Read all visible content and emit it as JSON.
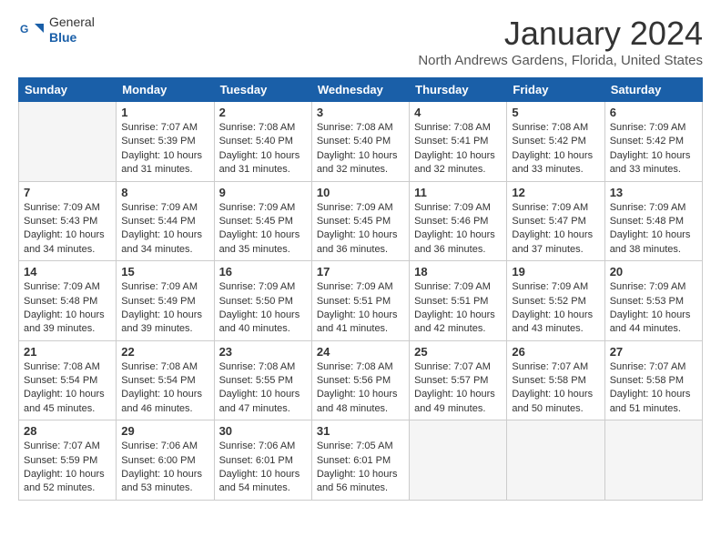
{
  "header": {
    "logo_general": "General",
    "logo_blue": "Blue",
    "title": "January 2024",
    "subtitle": "North Andrews Gardens, Florida, United States"
  },
  "days_of_week": [
    "Sunday",
    "Monday",
    "Tuesday",
    "Wednesday",
    "Thursday",
    "Friday",
    "Saturday"
  ],
  "weeks": [
    [
      {
        "day": "",
        "empty": true
      },
      {
        "day": "1",
        "sunrise": "7:07 AM",
        "sunset": "5:39 PM",
        "daylight": "10 hours and 31 minutes."
      },
      {
        "day": "2",
        "sunrise": "7:08 AM",
        "sunset": "5:40 PM",
        "daylight": "10 hours and 31 minutes."
      },
      {
        "day": "3",
        "sunrise": "7:08 AM",
        "sunset": "5:40 PM",
        "daylight": "10 hours and 32 minutes."
      },
      {
        "day": "4",
        "sunrise": "7:08 AM",
        "sunset": "5:41 PM",
        "daylight": "10 hours and 32 minutes."
      },
      {
        "day": "5",
        "sunrise": "7:08 AM",
        "sunset": "5:42 PM",
        "daylight": "10 hours and 33 minutes."
      },
      {
        "day": "6",
        "sunrise": "7:09 AM",
        "sunset": "5:42 PM",
        "daylight": "10 hours and 33 minutes."
      }
    ],
    [
      {
        "day": "7",
        "sunrise": "7:09 AM",
        "sunset": "5:43 PM",
        "daylight": "10 hours and 34 minutes."
      },
      {
        "day": "8",
        "sunrise": "7:09 AM",
        "sunset": "5:44 PM",
        "daylight": "10 hours and 34 minutes."
      },
      {
        "day": "9",
        "sunrise": "7:09 AM",
        "sunset": "5:45 PM",
        "daylight": "10 hours and 35 minutes."
      },
      {
        "day": "10",
        "sunrise": "7:09 AM",
        "sunset": "5:45 PM",
        "daylight": "10 hours and 36 minutes."
      },
      {
        "day": "11",
        "sunrise": "7:09 AM",
        "sunset": "5:46 PM",
        "daylight": "10 hours and 36 minutes."
      },
      {
        "day": "12",
        "sunrise": "7:09 AM",
        "sunset": "5:47 PM",
        "daylight": "10 hours and 37 minutes."
      },
      {
        "day": "13",
        "sunrise": "7:09 AM",
        "sunset": "5:48 PM",
        "daylight": "10 hours and 38 minutes."
      }
    ],
    [
      {
        "day": "14",
        "sunrise": "7:09 AM",
        "sunset": "5:48 PM",
        "daylight": "10 hours and 39 minutes."
      },
      {
        "day": "15",
        "sunrise": "7:09 AM",
        "sunset": "5:49 PM",
        "daylight": "10 hours and 39 minutes."
      },
      {
        "day": "16",
        "sunrise": "7:09 AM",
        "sunset": "5:50 PM",
        "daylight": "10 hours and 40 minutes."
      },
      {
        "day": "17",
        "sunrise": "7:09 AM",
        "sunset": "5:51 PM",
        "daylight": "10 hours and 41 minutes."
      },
      {
        "day": "18",
        "sunrise": "7:09 AM",
        "sunset": "5:51 PM",
        "daylight": "10 hours and 42 minutes."
      },
      {
        "day": "19",
        "sunrise": "7:09 AM",
        "sunset": "5:52 PM",
        "daylight": "10 hours and 43 minutes."
      },
      {
        "day": "20",
        "sunrise": "7:09 AM",
        "sunset": "5:53 PM",
        "daylight": "10 hours and 44 minutes."
      }
    ],
    [
      {
        "day": "21",
        "sunrise": "7:08 AM",
        "sunset": "5:54 PM",
        "daylight": "10 hours and 45 minutes."
      },
      {
        "day": "22",
        "sunrise": "7:08 AM",
        "sunset": "5:54 PM",
        "daylight": "10 hours and 46 minutes."
      },
      {
        "day": "23",
        "sunrise": "7:08 AM",
        "sunset": "5:55 PM",
        "daylight": "10 hours and 47 minutes."
      },
      {
        "day": "24",
        "sunrise": "7:08 AM",
        "sunset": "5:56 PM",
        "daylight": "10 hours and 48 minutes."
      },
      {
        "day": "25",
        "sunrise": "7:07 AM",
        "sunset": "5:57 PM",
        "daylight": "10 hours and 49 minutes."
      },
      {
        "day": "26",
        "sunrise": "7:07 AM",
        "sunset": "5:58 PM",
        "daylight": "10 hours and 50 minutes."
      },
      {
        "day": "27",
        "sunrise": "7:07 AM",
        "sunset": "5:58 PM",
        "daylight": "10 hours and 51 minutes."
      }
    ],
    [
      {
        "day": "28",
        "sunrise": "7:07 AM",
        "sunset": "5:59 PM",
        "daylight": "10 hours and 52 minutes."
      },
      {
        "day": "29",
        "sunrise": "7:06 AM",
        "sunset": "6:00 PM",
        "daylight": "10 hours and 53 minutes."
      },
      {
        "day": "30",
        "sunrise": "7:06 AM",
        "sunset": "6:01 PM",
        "daylight": "10 hours and 54 minutes."
      },
      {
        "day": "31",
        "sunrise": "7:05 AM",
        "sunset": "6:01 PM",
        "daylight": "10 hours and 56 minutes."
      },
      {
        "day": "",
        "empty": true
      },
      {
        "day": "",
        "empty": true
      },
      {
        "day": "",
        "empty": true
      }
    ]
  ]
}
